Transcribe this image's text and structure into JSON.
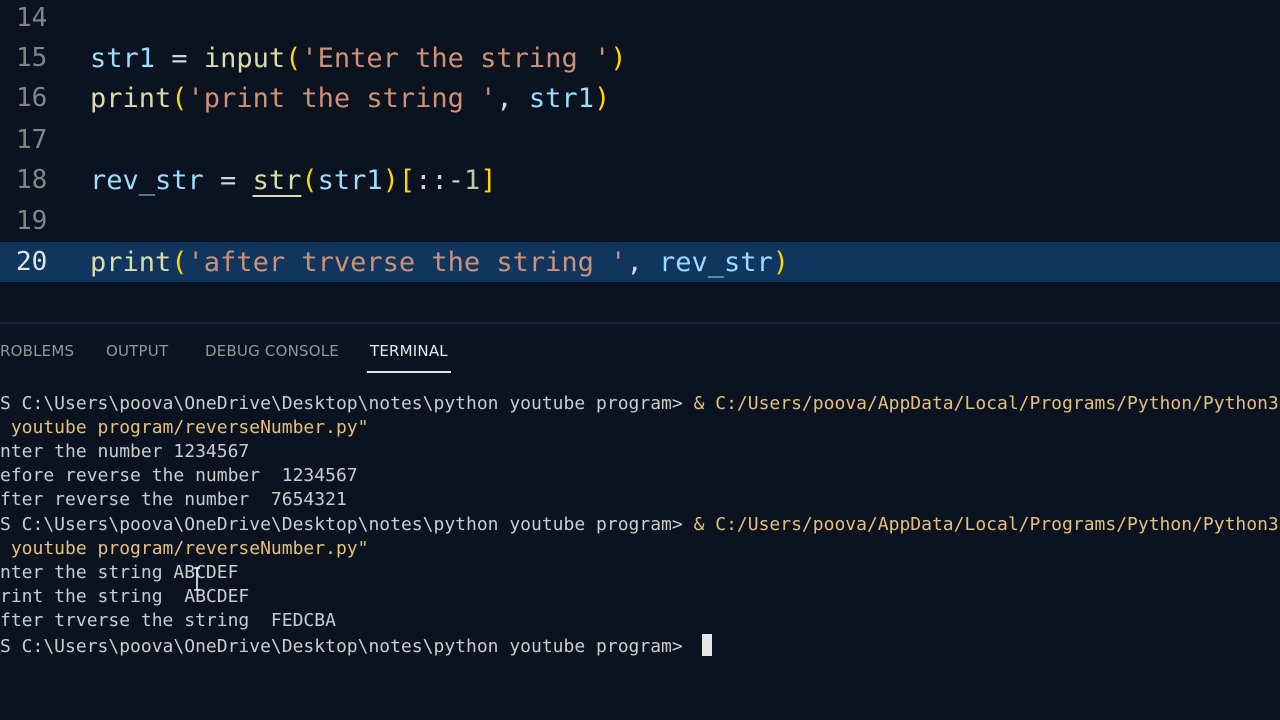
{
  "editor": {
    "lines": [
      {
        "number": "14",
        "parts": []
      },
      {
        "number": "15",
        "parts": [
          "str1",
          " = ",
          "input",
          "(",
          "'Enter the string '",
          ")"
        ]
      },
      {
        "number": "16",
        "parts": [
          "print",
          "(",
          "'print the string '",
          ", ",
          "str1",
          ")"
        ]
      },
      {
        "number": "17",
        "parts": []
      },
      {
        "number": "18",
        "parts": [
          "rev_str",
          " = ",
          "str",
          "(",
          "str1",
          ")",
          "[",
          "::",
          "-",
          "1",
          "]"
        ]
      },
      {
        "number": "19",
        "parts": []
      },
      {
        "number": "20",
        "parts": [
          "print",
          "(",
          "'after trverse the string '",
          ", ",
          "rev_str",
          ")"
        ]
      }
    ]
  },
  "panel": {
    "tabs": [
      "ROBLEMS",
      "OUTPUT",
      "DEBUG CONSOLE",
      "TERMINAL"
    ],
    "active_tab": "TERMINAL"
  },
  "terminal": {
    "lines": [
      {
        "prompt": "S C:\\Users\\poova\\OneDrive\\Desktop\\notes\\python youtube program> ",
        "cmd": "& C:/Users/poova/AppData/Local/Programs/Python/Python3"
      },
      {
        "text": " youtube program/reverseNumber.py\""
      },
      {
        "text": "nter the number 1234567"
      },
      {
        "text": "efore reverse the number  1234567"
      },
      {
        "text": "fter reverse the number  7654321"
      },
      {
        "prompt": "S C:\\Users\\poova\\OneDrive\\Desktop\\notes\\python youtube program> ",
        "cmd": "& C:/Users/poova/AppData/Local/Programs/Python/Python3"
      },
      {
        "text": " youtube program/reverseNumber.py\""
      },
      {
        "text": "nter the string ABCDEF"
      },
      {
        "text": "rint the string  ABCDEF"
      },
      {
        "text": "fter trverse the string  FEDCBA"
      },
      {
        "prompt": "S C:\\Users\\poova\\OneDrive\\Desktop\\notes\\python youtube program> ",
        "cmd": ""
      }
    ]
  }
}
